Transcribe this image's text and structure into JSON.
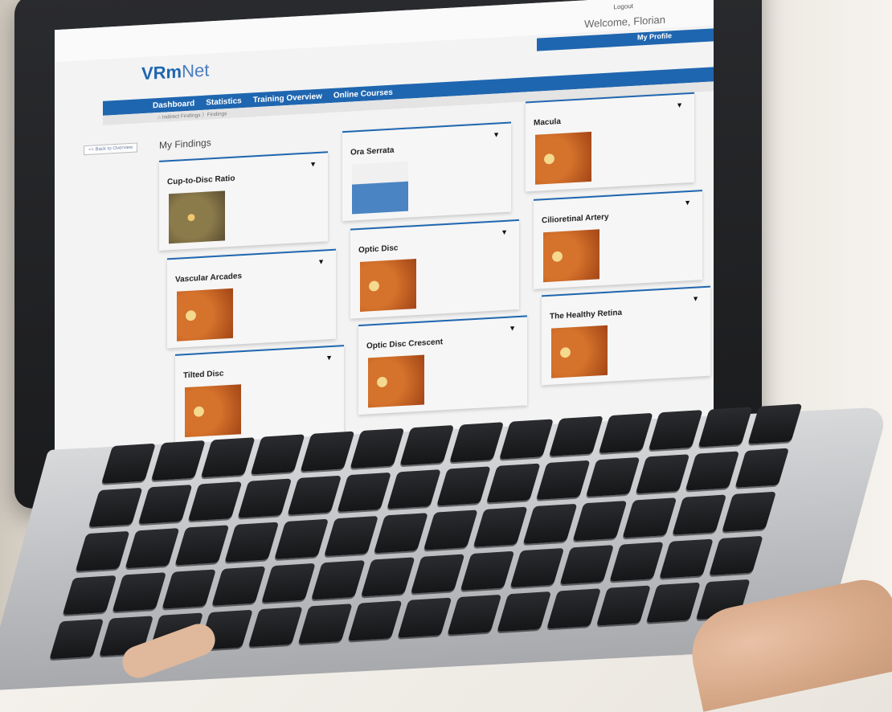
{
  "header": {
    "logout": "Logout",
    "welcome": "Welcome, Florian",
    "profile": "My Profile",
    "logo_bold": "VRm",
    "logo_rest": "Net"
  },
  "nav": {
    "items": [
      "Dashboard",
      "Statistics",
      "Training Overview",
      "Online Courses"
    ]
  },
  "breadcrumb": "Indirect Findings 〉Findings",
  "back_button": "<< Back to Overview",
  "page_title": "My Findings",
  "cards": [
    {
      "title": "Cup-to-Disc Ratio"
    },
    {
      "title": "Ora Serrata"
    },
    {
      "title": "Macula"
    },
    {
      "title": "Vascular Arcades"
    },
    {
      "title": "Optic Disc"
    },
    {
      "title": "Cilioretinal Artery"
    },
    {
      "title": "Tilted Disc"
    },
    {
      "title": "Optic Disc Crescent"
    },
    {
      "title": "The Healthy Retina"
    }
  ],
  "card_menu_glyph": "▼",
  "home_icon": "home-icon",
  "colors": {
    "brand_blue": "#1f66b0",
    "page_bg": "#f3f3f3"
  }
}
